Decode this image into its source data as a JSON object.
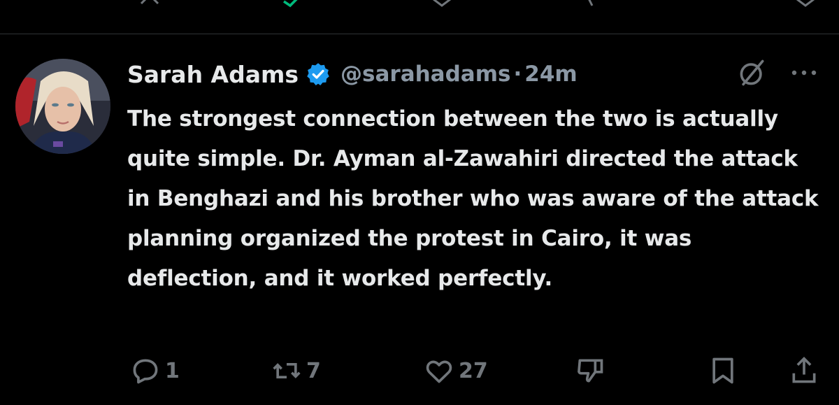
{
  "tweet": {
    "author_name": "Sarah Adams",
    "handle": "@sarahadams",
    "separator": "·",
    "time": "24m",
    "text": "The strongest connection between the two is actually quite simple. Dr. Ayman al-Zawahiri directed the attack in Benghazi and his brother who was aware of the attack planning organized the protest in Cairo, it was deflection, and it worked perfectly.",
    "stats": {
      "replies": "1",
      "reposts": "7",
      "likes": "27"
    }
  },
  "icons": {
    "verified": "verified-badge-icon",
    "grok": "grok-icon",
    "more": "more-icon",
    "reply": "reply-icon",
    "repost": "repost-icon",
    "like": "like-icon",
    "dislike": "dislike-icon",
    "bookmark": "bookmark-icon",
    "share": "share-icon"
  },
  "colors": {
    "background": "#000000",
    "text": "#e7e9ea",
    "muted": "#71767b",
    "verified": "#1d9bf0"
  }
}
